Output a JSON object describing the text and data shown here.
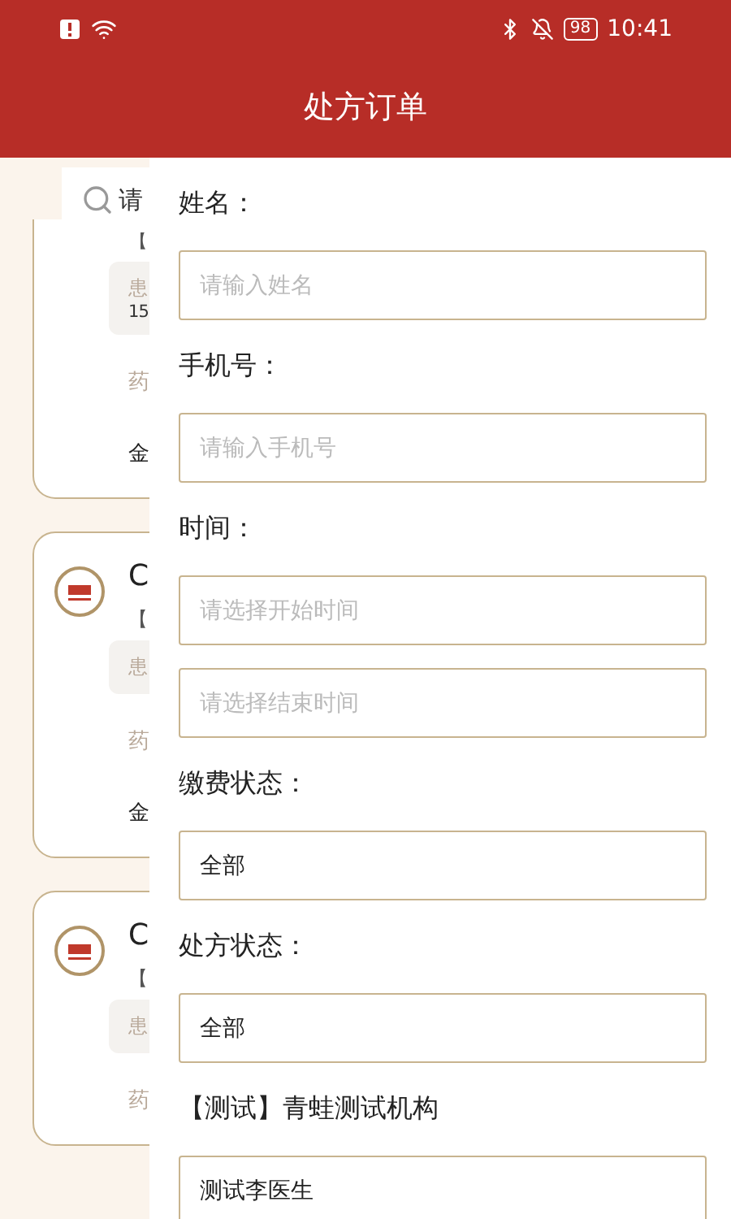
{
  "status_bar": {
    "battery": "98",
    "time": "10:41"
  },
  "header": {
    "title": "处方订单"
  },
  "background": {
    "search": {
      "placeholder": "请"
    },
    "cards": [
      {
        "has_logo": false,
        "tag": "【",
        "patient_lines": [
          "患",
          "15"
        ],
        "medicine": "药",
        "amount": "金"
      },
      {
        "has_logo": true,
        "title": "C",
        "tag": "【",
        "patient_lines": [
          "患"
        ],
        "medicine": "药",
        "amount": "金"
      },
      {
        "has_logo": true,
        "title": "C",
        "tag": "【",
        "patient_lines": [
          "患"
        ],
        "medicine": "药"
      }
    ]
  },
  "filter": {
    "sections": [
      {
        "label": "姓名：",
        "fields": [
          {
            "placeholder": "请输入姓名"
          }
        ]
      },
      {
        "label": "手机号：",
        "fields": [
          {
            "placeholder": "请输入手机号"
          }
        ]
      },
      {
        "label": "时间：",
        "fields": [
          {
            "placeholder": "请选择开始时间"
          },
          {
            "placeholder": "请选择结束时间"
          }
        ]
      },
      {
        "label": "缴费状态：",
        "fields": [
          {
            "value": "全部"
          }
        ]
      },
      {
        "label": "处方状态：",
        "fields": [
          {
            "value": "全部"
          }
        ]
      },
      {
        "label": "【测试】青蛙测试机构",
        "fields": [
          {
            "value": "测试李医生"
          }
        ]
      }
    ]
  }
}
